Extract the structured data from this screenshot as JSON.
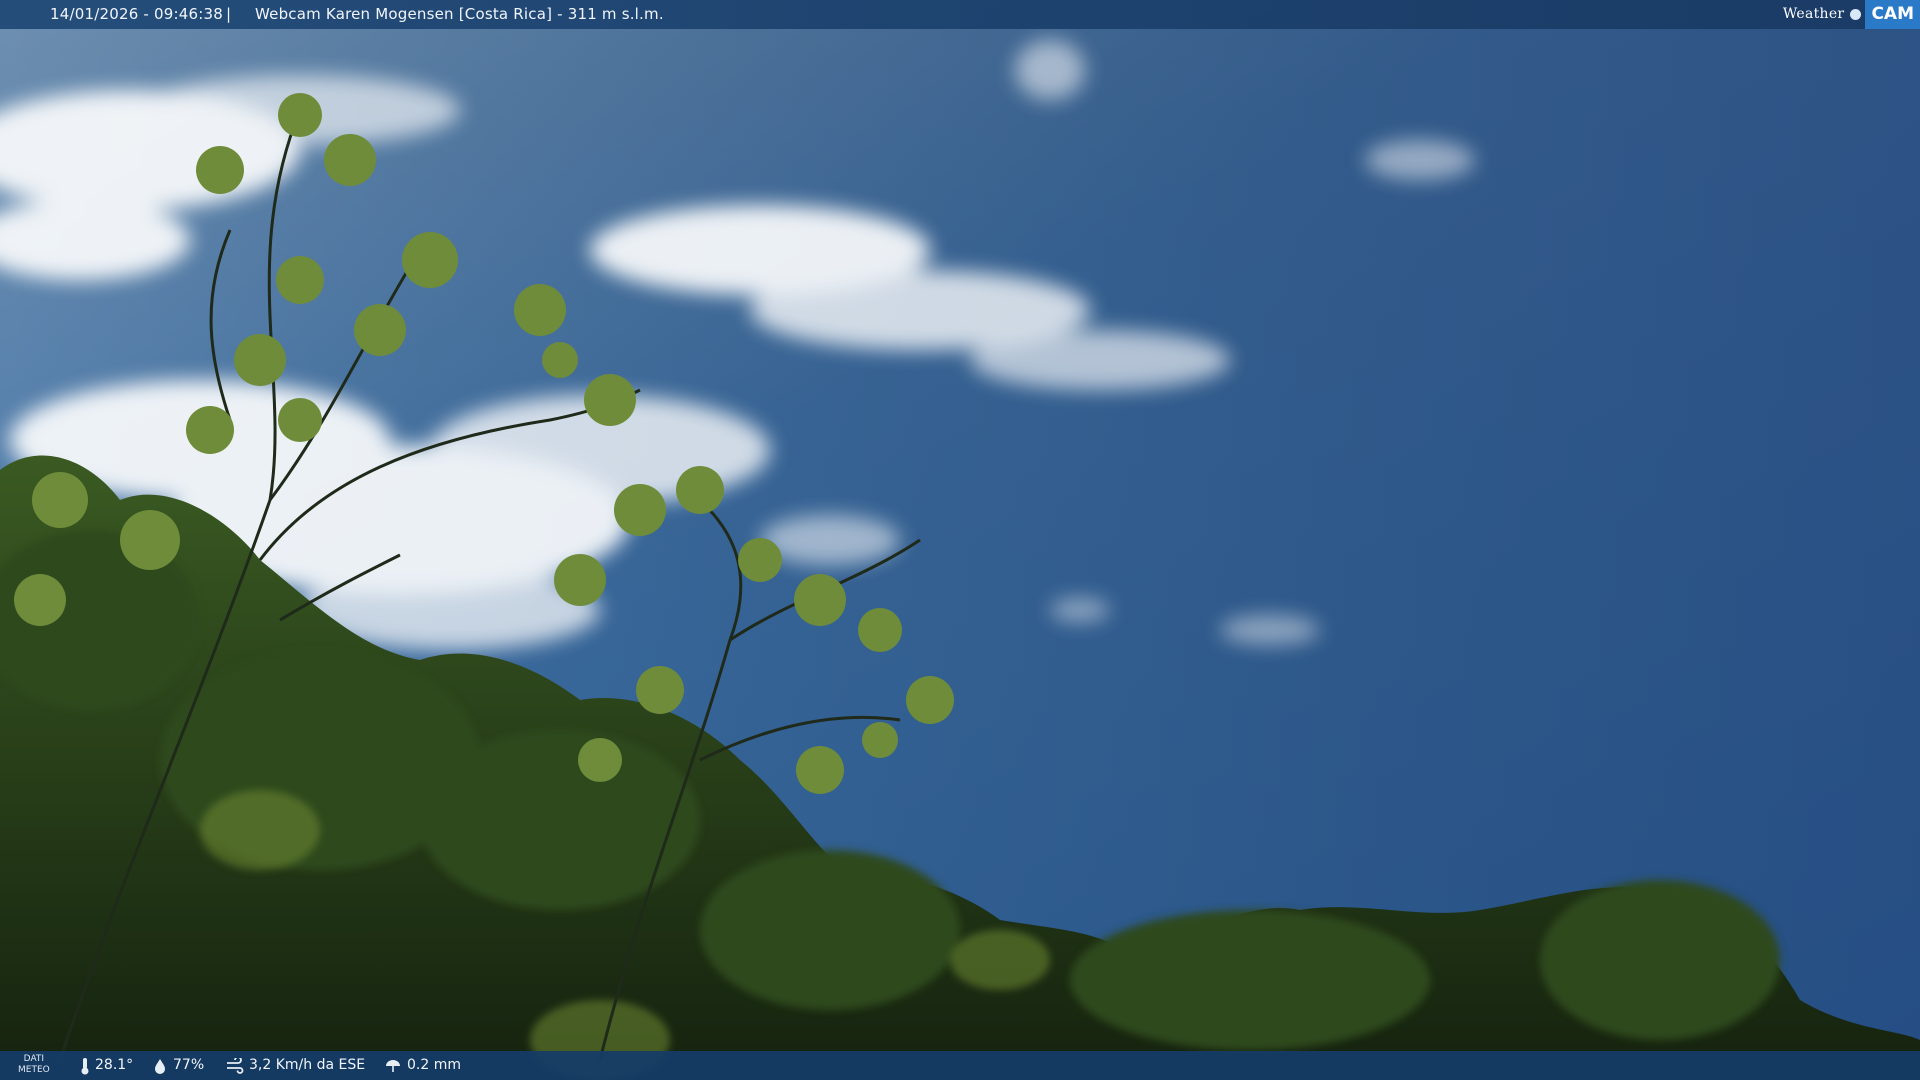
{
  "header": {
    "datetime": "14/01/2026 - 09:46:38",
    "separator": "|",
    "webcam_title": "Webcam Karen Mogensen [Costa Rica] - 311 m s.l.m.",
    "logo_weather": "Weather",
    "logo_cam": "CAM"
  },
  "footer": {
    "dati_line1": "DATI",
    "dati_line2": "METEO",
    "temperature": "28.1°",
    "humidity": "77%",
    "wind": "3,2 Km/h da ESE",
    "rain": "0.2 mm",
    "icons": [
      "thermometer-icon",
      "drop-icon",
      "wind-icon",
      "rain-icon"
    ]
  },
  "colors": {
    "sky_top": "#4d6f98",
    "sky_bottom": "#2d6aa8",
    "bar": "#1c4a7c",
    "logo_accent": "#2a7ac7"
  }
}
